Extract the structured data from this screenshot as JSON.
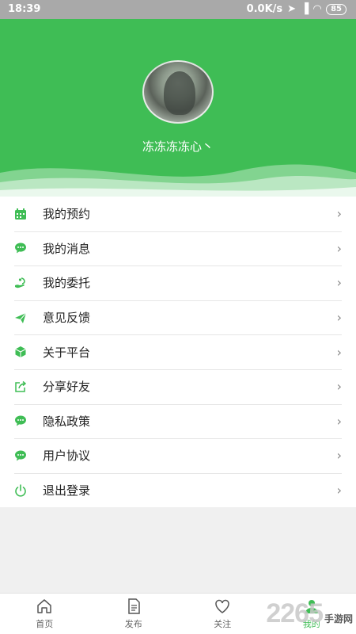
{
  "status_bar": {
    "time": "18:39",
    "network_speed": "0.0K/s",
    "battery": "85"
  },
  "profile": {
    "username": "冻冻冻冻心丶"
  },
  "menu": [
    {
      "label": "我的预约",
      "icon": "calendar-icon"
    },
    {
      "label": "我的消息",
      "icon": "chat-bubble-icon"
    },
    {
      "label": "我的委托",
      "icon": "hand-icon"
    },
    {
      "label": "意见反馈",
      "icon": "paper-plane-icon"
    },
    {
      "label": "关于平台",
      "icon": "cube-icon"
    },
    {
      "label": "分享好友",
      "icon": "share-icon"
    },
    {
      "label": "隐私政策",
      "icon": "chat-bubble-icon"
    },
    {
      "label": "用户协议",
      "icon": "chat-bubble-icon"
    },
    {
      "label": "退出登录",
      "icon": "power-icon"
    }
  ],
  "tabs": [
    {
      "label": "首页",
      "icon": "home-icon"
    },
    {
      "label": "发布",
      "icon": "document-icon"
    },
    {
      "label": "关注",
      "icon": "heart-icon"
    },
    {
      "label": "我的",
      "icon": "person-icon",
      "active": true
    }
  ],
  "watermark": {
    "number": "2265",
    "text": "手游网"
  },
  "colors": {
    "accent": "#3fbd55",
    "status_bar": "#a9a9a9",
    "background": "#f0f0f0"
  }
}
